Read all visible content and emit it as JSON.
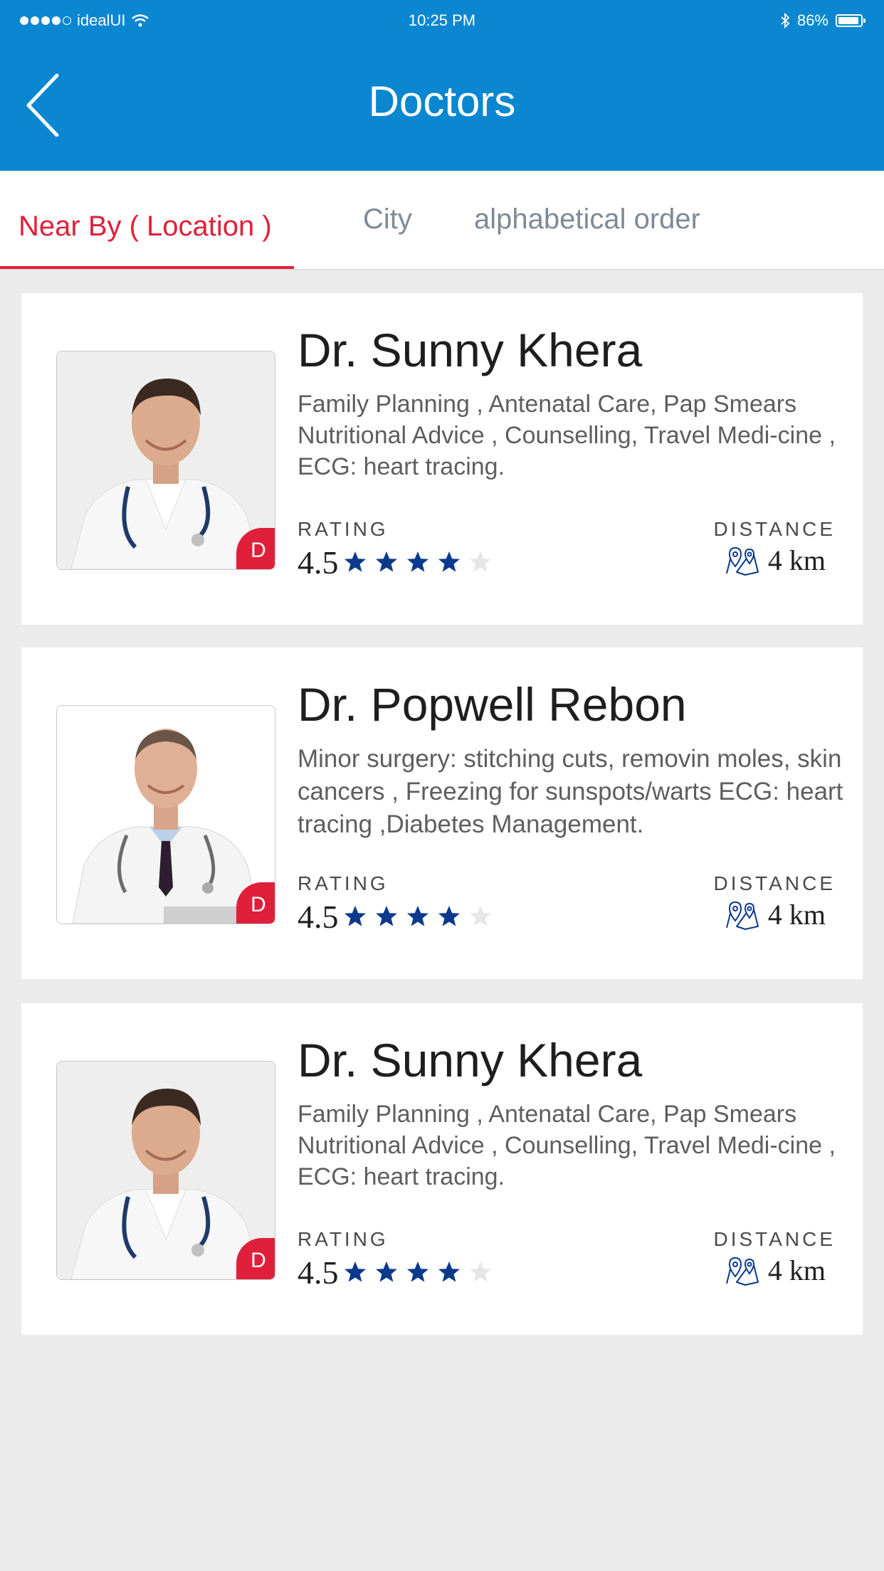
{
  "status_bar": {
    "carrier": "idealUI",
    "time": "10:25 PM",
    "battery": "86%"
  },
  "header": {
    "title": "Doctors"
  },
  "tabs": [
    {
      "label": "Near By ( Location )",
      "active": true
    },
    {
      "label": "City",
      "active": false
    },
    {
      "label": "alphabetical order",
      "active": false
    }
  ],
  "labels": {
    "rating": "RATING",
    "distance": "DISTANCE"
  },
  "doctors": [
    {
      "name": "Dr. Sunny Khera",
      "specialties": "Family Planning , Antenatal Care, Pap Smears Nutritional Advice , Counselling, Travel Medi-cine , ECG: heart tracing.",
      "rating": "4.5",
      "stars": 4,
      "distance": "4 km",
      "badge": "D"
    },
    {
      "name": "Dr. Popwell Rebon",
      "specialties": "Minor surgery: stitching cuts, removin moles, skin cancers , Freezing for sunspots/warts ECG: heart tracing ,Diabetes Management.",
      "rating": "4.5",
      "stars": 4,
      "distance": "4 km",
      "badge": "D"
    },
    {
      "name": "Dr. Sunny Khera",
      "specialties": "Family Planning , Antenatal Care, Pap Smears Nutritional Advice , Counselling, Travel Medi-cine , ECG: heart tracing.",
      "rating": "4.5",
      "stars": 4,
      "distance": "4 km",
      "badge": "D"
    }
  ],
  "colors": {
    "header": "#0a87d0",
    "accent": "#e0203a",
    "star_filled": "#0b3a8c",
    "star_empty": "#e6e6e6"
  }
}
